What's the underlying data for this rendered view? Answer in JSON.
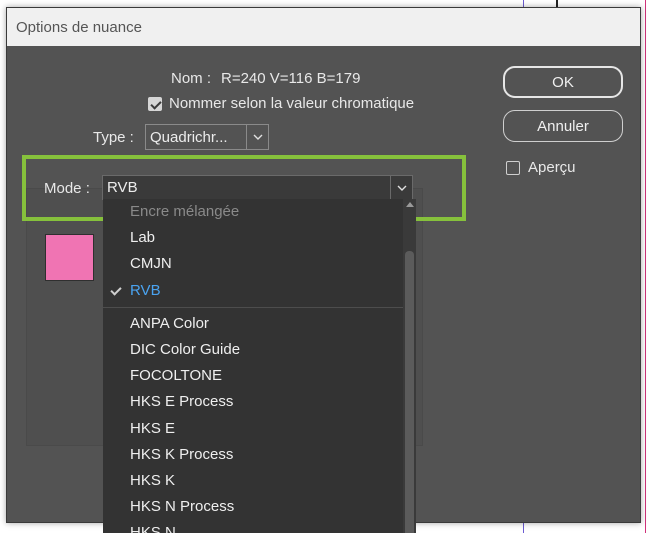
{
  "dialog": {
    "title": "Options de nuance",
    "nom_label": "Nom :",
    "nom_value": "R=240 V=116 B=179",
    "name_by_value_checkbox": "Nommer selon la valeur chromatique",
    "name_by_value_checked": true,
    "type_label": "Type :",
    "type_value": "Quadrichr...",
    "mode_label": "Mode :",
    "mode_value": "RVB",
    "swatch_color": "#f074b3",
    "ok_label": "OK",
    "cancel_label": "Annuler",
    "preview_label": "Aperçu",
    "preview_checked": false
  },
  "mode_dropdown": {
    "items": [
      {
        "label": "Encre mélangée",
        "state": "disabled"
      },
      {
        "label": "Lab",
        "state": "normal"
      },
      {
        "label": "CMJN",
        "state": "normal"
      },
      {
        "label": "RVB",
        "state": "selected"
      },
      {
        "label": "ANPA Color",
        "state": "normal"
      },
      {
        "label": "DIC Color Guide",
        "state": "normal"
      },
      {
        "label": "FOCOLTONE",
        "state": "normal"
      },
      {
        "label": "HKS E Process",
        "state": "normal"
      },
      {
        "label": "HKS E",
        "state": "normal"
      },
      {
        "label": "HKS K Process",
        "state": "normal"
      },
      {
        "label": "HKS K",
        "state": "normal"
      },
      {
        "label": "HKS N Process",
        "state": "normal"
      },
      {
        "label": "HKS N",
        "state": "normal"
      }
    ]
  },
  "colors": {
    "dialog_bg": "#535353",
    "highlight": "#86c13c",
    "selected_text": "#4aa3f0"
  }
}
